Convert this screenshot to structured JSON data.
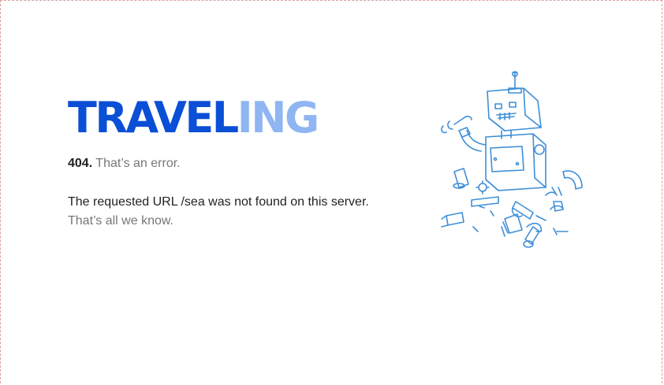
{
  "logo": {
    "part_dark": "TRAVEL",
    "part_light": "ING",
    "color_dark": "#0a4fd6",
    "color_light": "#8fb6f2"
  },
  "error": {
    "code": "404.",
    "short": "That’s an error."
  },
  "message": {
    "line1": "The requested URL /sea was not found on this server.",
    "line2": "That’s all we know."
  },
  "illustration": {
    "icon": "broken-robot-icon",
    "stroke_color": "#3f8fd8"
  }
}
